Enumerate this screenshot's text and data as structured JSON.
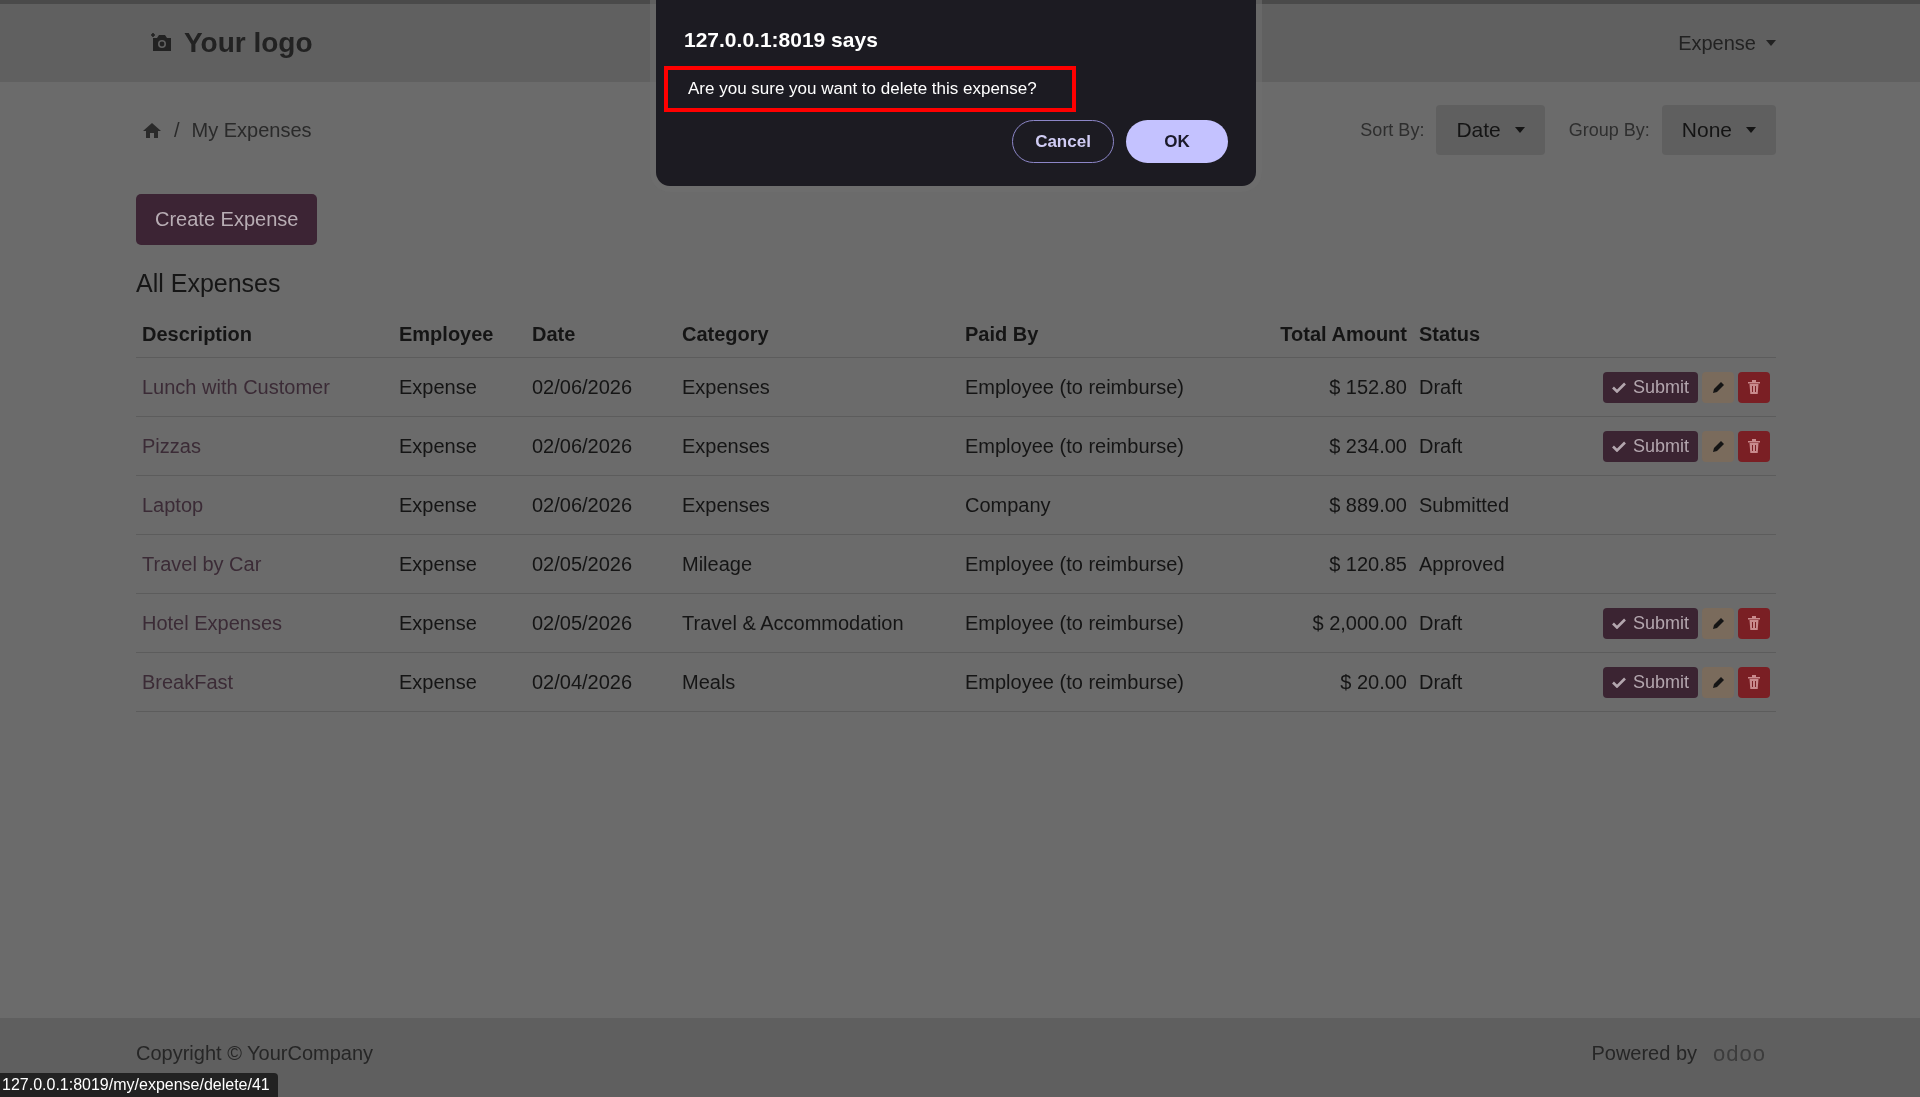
{
  "header": {
    "logo": "Your logo",
    "menu": "Expense"
  },
  "breadcrumb": {
    "separator": "/",
    "current": "My Expenses"
  },
  "sort": {
    "label": "Sort By:",
    "value": "Date"
  },
  "group": {
    "label": "Group By:",
    "value": "None"
  },
  "create_button": "Create Expense",
  "table": {
    "title": "All Expenses",
    "columns": [
      "Description",
      "Employee",
      "Date",
      "Category",
      "Paid By",
      "Total Amount",
      "Status"
    ],
    "rows": [
      {
        "description": "Lunch with Customer",
        "employee": "Expense",
        "date": "02/06/2026",
        "category": "Expenses",
        "paid_by": "Employee (to reimburse)",
        "total": "$ 152.80",
        "status": "Draft",
        "submit": "Submit"
      },
      {
        "description": "Pizzas",
        "employee": "Expense",
        "date": "02/06/2026",
        "category": "Expenses",
        "paid_by": "Employee (to reimburse)",
        "total": "$ 234.00",
        "status": "Draft",
        "submit": "Submit"
      },
      {
        "description": "Laptop",
        "employee": "Expense",
        "date": "02/06/2026",
        "category": "Expenses",
        "paid_by": "Company",
        "total": "$ 889.00",
        "status": "Submitted"
      },
      {
        "description": "Travel by Car",
        "employee": "Expense",
        "date": "02/05/2026",
        "category": "Mileage",
        "paid_by": "Employee (to reimburse)",
        "total": "$ 120.85",
        "status": "Approved"
      },
      {
        "description": "Hotel Expenses",
        "employee": "Expense",
        "date": "02/05/2026",
        "category": "Travel & Accommodation",
        "paid_by": "Employee (to reimburse)",
        "total": "$ 2,000.00",
        "status": "Draft",
        "submit": "Submit"
      },
      {
        "description": "BreakFast",
        "employee": "Expense",
        "date": "02/04/2026",
        "category": "Meals",
        "paid_by": "Employee (to reimburse)",
        "total": "$ 20.00",
        "status": "Draft",
        "submit": "Submit"
      }
    ]
  },
  "footer": {
    "copyright": "Copyright © YourCompany",
    "powered_by": "Powered by",
    "brand": "odoo"
  },
  "status_url": "127.0.0.1:8019/my/expense/delete/41",
  "dialog": {
    "title": "127.0.0.1:8019 says",
    "message": "Are you sure you want to delete this expense?",
    "highlighted": true,
    "buttons": [
      "Cancel",
      "OK"
    ]
  }
}
